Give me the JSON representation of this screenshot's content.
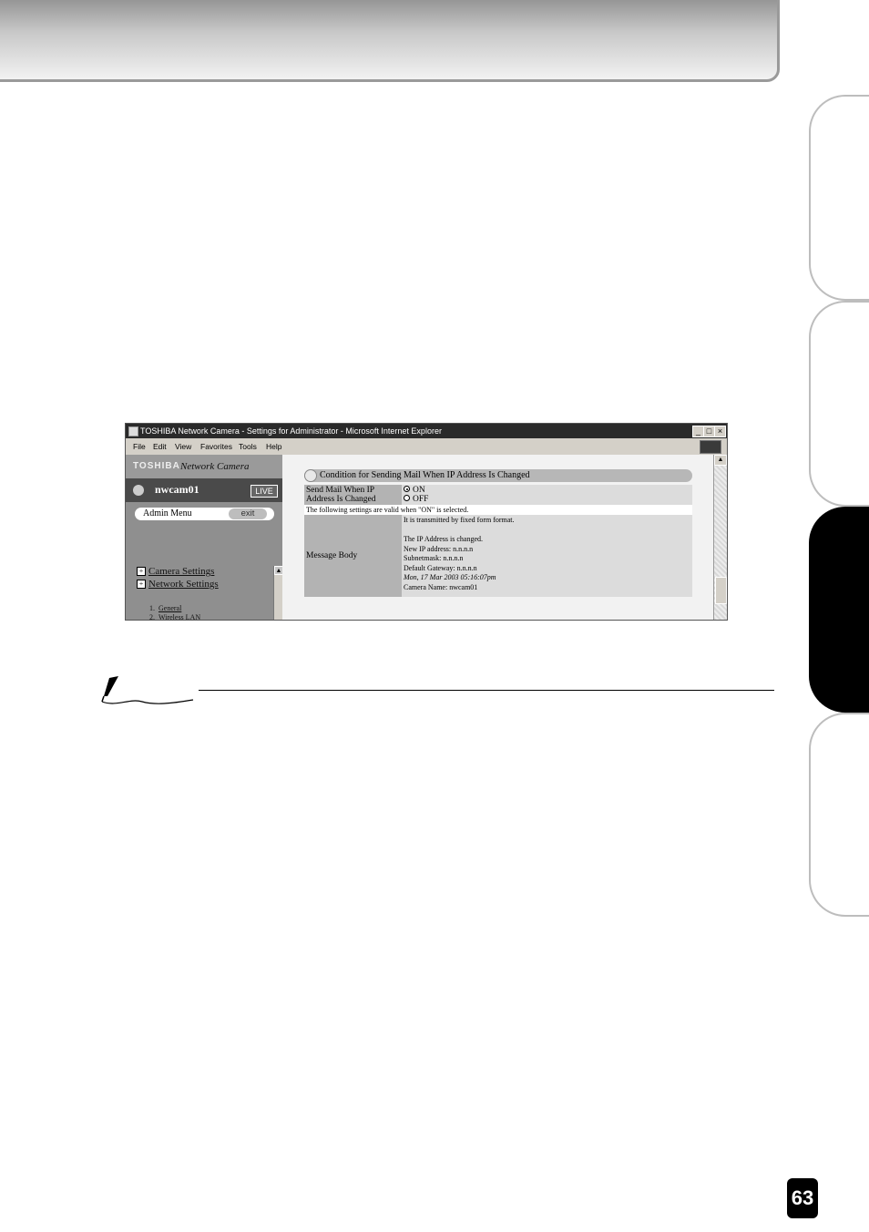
{
  "browser": {
    "title": "TOSHIBA Network Camera - Settings for Administrator - Microsoft Internet Explorer",
    "menu": [
      "File",
      "Edit",
      "View",
      "Favorites",
      "Tools",
      "Help"
    ]
  },
  "sidebar": {
    "brand_logo": "TOSHIBA",
    "brand_product": "Network Camera",
    "camera_name": "nwcam01",
    "live_label": "LIVE",
    "admin_menu_label": "Admin Menu",
    "exit_label": "exit",
    "nav": [
      "Camera Settings",
      "Network Settings"
    ],
    "sub_items": [
      {
        "num": "1.",
        "label": "General"
      },
      {
        "num": "2.",
        "label": "Wireless LAN"
      }
    ]
  },
  "form": {
    "section_title": "Condition for Sending Mail When IP Address Is Changed",
    "send_mail_label_1": "Send Mail When IP",
    "send_mail_label_2": "Address Is Changed",
    "options": [
      "ON",
      "OFF"
    ],
    "selected_option": "ON",
    "note": "The following settings are valid when \"ON\" is selected.",
    "message_body_label": "Message Body",
    "message_lines": [
      "It is transmitted by fixed form format.",
      "",
      "The IP Address is changed.",
      "New IP address: n.n.n.n",
      "Subnetmask: n.n.n.n",
      "Default Gateway: n.n.n.n",
      "Mon, 17 Mar 2003 05:16:07pm",
      "Camera Name: nwcam01"
    ]
  },
  "page_number": "63"
}
